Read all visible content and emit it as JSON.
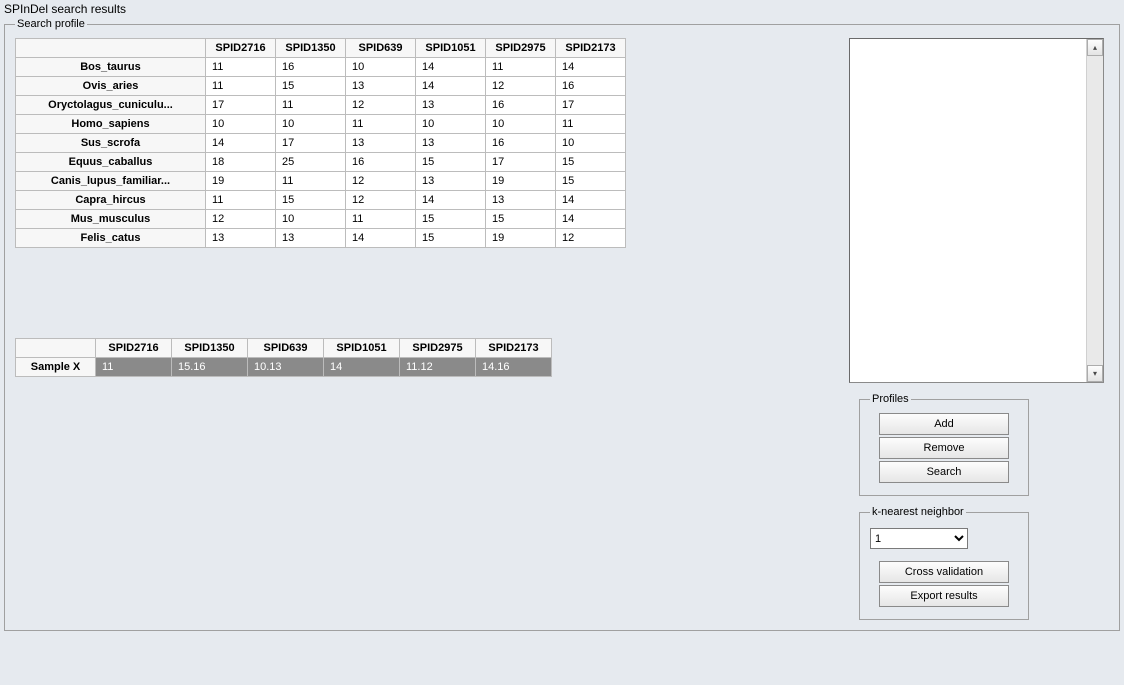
{
  "window_title": "SPInDel search results",
  "search_profile_legend": "Search profile",
  "columns": [
    "SPID2716",
    "SPID1350",
    "SPID639",
    "SPID1051",
    "SPID2975",
    "SPID2173"
  ],
  "rows": [
    {
      "name": "Bos_taurus",
      "values": [
        "11",
        "16",
        "10",
        "14",
        "11",
        "14"
      ]
    },
    {
      "name": "Ovis_aries",
      "values": [
        "11",
        "15",
        "13",
        "14",
        "12",
        "16"
      ]
    },
    {
      "name": "Oryctolagus_cuniculu...",
      "values": [
        "17",
        "11",
        "12",
        "13",
        "16",
        "17"
      ]
    },
    {
      "name": "Homo_sapiens",
      "values": [
        "10",
        "10",
        "11",
        "10",
        "10",
        "11"
      ]
    },
    {
      "name": "Sus_scrofa",
      "values": [
        "14",
        "17",
        "13",
        "13",
        "16",
        "10"
      ]
    },
    {
      "name": "Equus_caballus",
      "values": [
        "18",
        "25",
        "16",
        "15",
        "17",
        "15"
      ]
    },
    {
      "name": "Canis_lupus_familiar...",
      "values": [
        "19",
        "11",
        "12",
        "13",
        "19",
        "15"
      ]
    },
    {
      "name": "Capra_hircus",
      "values": [
        "11",
        "15",
        "12",
        "14",
        "13",
        "14"
      ]
    },
    {
      "name": "Mus_musculus",
      "values": [
        "12",
        "10",
        "11",
        "15",
        "15",
        "14"
      ]
    },
    {
      "name": "Felis_catus",
      "values": [
        "13",
        "13",
        "14",
        "15",
        "19",
        "12"
      ]
    }
  ],
  "sample": {
    "name": "Sample X",
    "values": [
      "11",
      "15.16",
      "10.13",
      "14",
      "11.12",
      "14.16"
    ]
  },
  "profiles_panel": {
    "legend": "Profiles",
    "add": "Add",
    "remove": "Remove",
    "search": "Search"
  },
  "knn_panel": {
    "legend": "k-nearest neighbor",
    "selected": "1",
    "options": [
      "1"
    ],
    "cross_validation": "Cross validation",
    "export_results": "Export results"
  },
  "scroll_up_glyph": "▴",
  "scroll_down_glyph": "▾"
}
